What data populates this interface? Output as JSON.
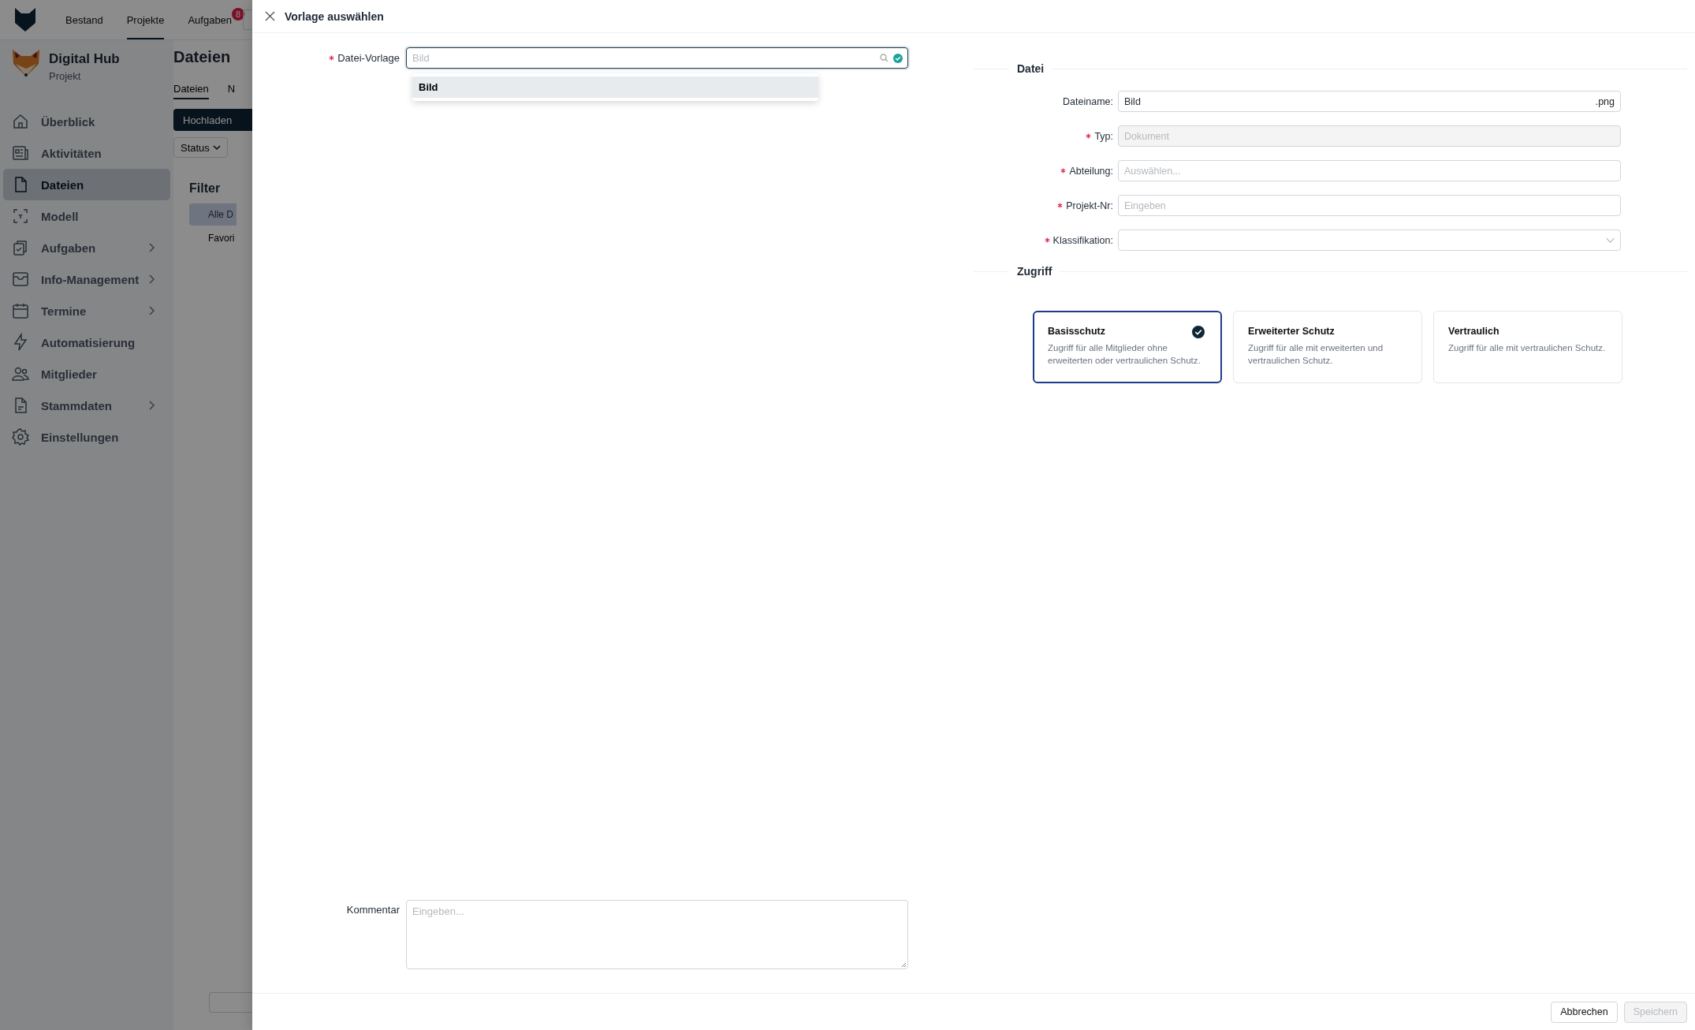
{
  "topbar": {
    "nav": [
      {
        "label": "Bestand",
        "selected": false
      },
      {
        "label": "Projekte",
        "selected": true
      },
      {
        "label": "Aufgaben",
        "selected": false,
        "badge": "8"
      }
    ]
  },
  "project": {
    "name": "Digital Hub",
    "type": "Projekt"
  },
  "sidebar": {
    "items": [
      {
        "label": "Überblick",
        "selected": false,
        "expandable": false
      },
      {
        "label": "Aktivitäten",
        "selected": false,
        "expandable": false
      },
      {
        "label": "Dateien",
        "selected": true,
        "expandable": false
      },
      {
        "label": "Modell",
        "selected": false,
        "expandable": false
      },
      {
        "label": "Aufgaben",
        "selected": false,
        "expandable": true
      },
      {
        "label": "Info-Management",
        "selected": false,
        "expandable": true
      },
      {
        "label": "Termine",
        "selected": false,
        "expandable": true
      },
      {
        "label": "Automatisierung",
        "selected": false,
        "expandable": false
      },
      {
        "label": "Mitglieder",
        "selected": false,
        "expandable": false
      },
      {
        "label": "Stammdaten",
        "selected": false,
        "expandable": true
      },
      {
        "label": "Einstellungen",
        "selected": false,
        "expandable": false
      }
    ]
  },
  "background_page": {
    "title": "Dateien",
    "tabs": [
      {
        "label": "Dateien",
        "selected": true
      },
      {
        "label": "N",
        "selected": false
      }
    ],
    "upload_button": "Hochladen",
    "status_filter": "Status",
    "filter_title": "Filter",
    "filters": [
      {
        "label": "Alle D",
        "selected": true
      },
      {
        "label": "Favori",
        "selected": false
      }
    ]
  },
  "dialog": {
    "title": "Vorlage auswählen",
    "template_field": {
      "label": "Datei-Vorlage",
      "required": true,
      "placeholder": "Bild",
      "valid": true
    },
    "dropdown": [
      {
        "label": "Bild",
        "selected": true
      }
    ],
    "comment": {
      "label": "Kommentar",
      "placeholder": "Eingeben..."
    },
    "file_section": {
      "title": "Datei",
      "fields": [
        {
          "kind": "text",
          "label": "Dateiname:",
          "required": false,
          "disabled": false,
          "value": "Bild",
          "suffix": ".png"
        },
        {
          "kind": "text",
          "label": "Typ:",
          "required": true,
          "disabled": true,
          "value": "Dokument"
        },
        {
          "kind": "text",
          "label": "Abteilung:",
          "required": true,
          "disabled": false,
          "placeholder": "Auswählen..."
        },
        {
          "kind": "text",
          "label": "Projekt-Nr:",
          "required": true,
          "disabled": false,
          "placeholder": "Eingeben"
        },
        {
          "kind": "select",
          "label": "Klassifikation:",
          "required": true,
          "disabled": false
        }
      ]
    },
    "access_section": {
      "title": "Zugriff",
      "options": [
        {
          "title": "Basisschutz",
          "description": "Zugriff für alle Mitglieder ohne erweiterten oder vertraulichen Schutz.",
          "selected": true
        },
        {
          "title": "Erweiterter Schutz",
          "description": "Zugriff für alle mit erweiterten und vertraulichen Schutz.",
          "selected": false
        },
        {
          "title": "Vertraulich",
          "description": "Zugriff für alle mit vertraulichen Schutz.",
          "selected": false
        }
      ]
    },
    "buttons": [
      {
        "label": "Abbrechen",
        "disabled": false
      },
      {
        "label": "Speichern",
        "disabled": true
      }
    ]
  }
}
